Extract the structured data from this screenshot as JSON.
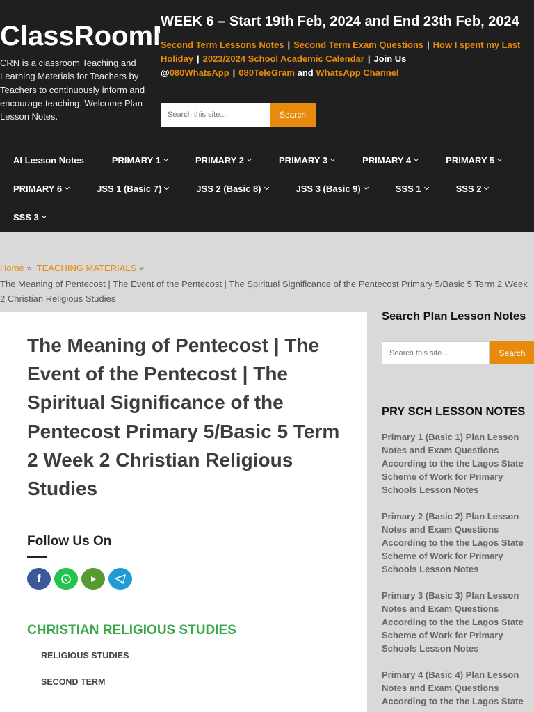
{
  "header": {
    "brand": "ClassRoomNotes",
    "tagline": "CRN is a classroom Teaching and Learning Materials for Teachers by Teachers to continuously inform and encourage teaching. Welcome Plan Lesson Notes.",
    "week": "WEEK 6 – Start 19th Feb, 2024 and End 23th Feb, 2024",
    "links": {
      "l1": "Second Term Lessons Notes",
      "l2": "Second Term Exam Questions",
      "l3": "How I spent my Last Holiday",
      "l4": "2023/2024 School Academic Calendar",
      "join_text": "Join Us @",
      "l5": "080WhatsApp",
      "l6": "080TeleGram",
      "and_text": "and",
      "l7": "WhatsApp Channel",
      "sep": "|"
    },
    "search": {
      "placeholder": "Search this site...",
      "button": "Search"
    }
  },
  "nav": {
    "row1": [
      "AI Lesson Notes",
      "PRIMARY 1",
      "PRIMARY 2",
      "PRIMARY 3",
      "PRIMARY 4",
      "PRIMARY 5"
    ],
    "row2": [
      "PRIMARY 6",
      "JSS 1 (Basic 7)",
      "JSS 2 (Basic 8)",
      "JSS 3 (Basic 9)",
      "SSS 1",
      "SSS 2"
    ],
    "row3": [
      "SSS 3"
    ]
  },
  "breadcrumb": {
    "home": "Home",
    "category": "TEACHING MATERIALS",
    "current": "The Meaning of Pentecost | The Event of the Pentecost | The Spiritual Significance of the Pentecost Primary 5/Basic 5 Term 2 Week 2 Christian Religious Studies"
  },
  "article": {
    "title": "The Meaning of Pentecost | The Event of the Pentecost | The Spiritual Significance of the Pentecost Primary 5/Basic 5 Term 2 Week 2 Christian Religious Studies",
    "follow": "Follow Us On",
    "social": [
      "facebook-icon",
      "whatsapp-icon",
      "youtube-icon",
      "telegram-icon"
    ],
    "category": "CHRISTIAN RELIGIOUS STUDIES",
    "tags": [
      "RELIGIOUS STUDIES",
      "SECOND TERM"
    ]
  },
  "sidebar": {
    "search_title": "Search Plan Lesson Notes",
    "search": {
      "placeholder": "Search this site...",
      "button": "Search"
    },
    "notes_title": "PRY SCH LESSON NOTES",
    "items": [
      "Primary 1 (Basic 1) Plan Lesson Notes and Exam Questions According to the the Lagos State Scheme of Work for Primary Schools Lesson Notes",
      "Primary 2 (Basic 2) Plan Lesson Notes and Exam Questions According to the the Lagos State Scheme of Work for Primary Schools Lesson Notes",
      "Primary 3 (Basic 3) Plan Lesson Notes and Exam Questions According to the the Lagos State Scheme of Work for Primary Schools Lesson Notes",
      "Primary 4 (Basic 4) Plan Lesson Notes and Exam Questions According to the the Lagos State"
    ]
  },
  "colors": {
    "accent": "#e88a0c",
    "header_bg": "#1f1f1f",
    "category": "#3aa84a",
    "page_bg": "#d9d9d9"
  }
}
